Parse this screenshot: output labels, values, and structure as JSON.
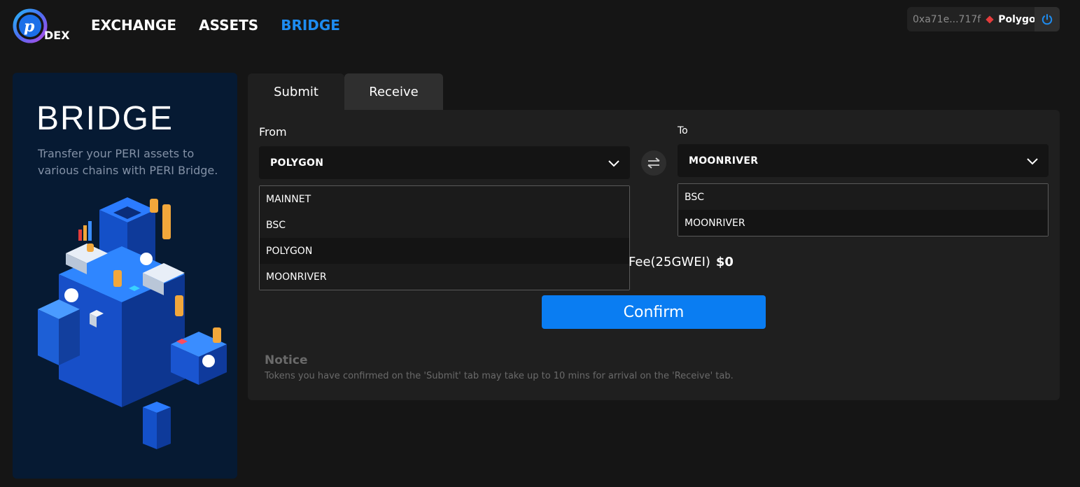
{
  "header": {
    "logo_text": "DEX",
    "nav": [
      {
        "label": "EXCHANGE",
        "active": false
      },
      {
        "label": "ASSETS",
        "active": false
      },
      {
        "label": "BRIDGE",
        "active": true
      }
    ],
    "wallet": {
      "address": "0xa71e...717f",
      "network": "Polygon",
      "network_color": "#e33c3c"
    },
    "accent_color": "#1e8cf0"
  },
  "left": {
    "title": "BRIDGE",
    "description": "Transfer your PERI assets to various chains with PERI Bridge."
  },
  "tabs": [
    {
      "label": "Submit"
    },
    {
      "label": "Receive"
    }
  ],
  "from": {
    "label": "From",
    "selected": "POLYGON",
    "options": [
      "MAINNET",
      "BSC",
      "POLYGON",
      "MOONRIVER"
    ],
    "highlighted": "POLYGON"
  },
  "to": {
    "label": "To",
    "selected": "MOONRIVER",
    "options": [
      "BSC",
      "MOONRIVER"
    ],
    "highlighted": "MOONRIVER"
  },
  "fee": {
    "label": "Fee(25GWEI)",
    "value": "$0"
  },
  "confirm_label": "Confirm",
  "notice": {
    "title": "Notice",
    "text": "Tokens you have confirmed on the 'Submit' tab may take up to 10 mins for arrival on the 'Receive' tab."
  }
}
